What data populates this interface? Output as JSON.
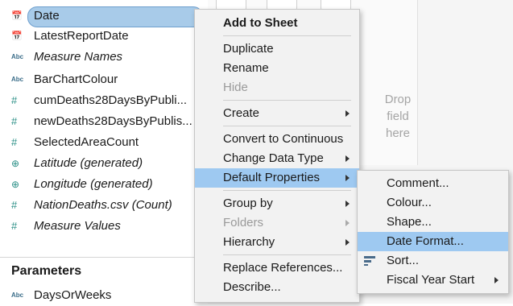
{
  "fields": [
    {
      "label": "Date",
      "icon": "calendar-icon",
      "italic": false,
      "selected": true
    },
    {
      "label": "LatestReportDate",
      "icon": "calendar-icon",
      "italic": false
    },
    {
      "label": "Measure Names",
      "icon": "abc-icon",
      "italic": true
    },
    {
      "label": "BarChartColour",
      "icon": "abc-icon",
      "italic": false
    },
    {
      "label": "cumDeaths28DaysByPubli...",
      "icon": "number-icon",
      "italic": false
    },
    {
      "label": "newDeaths28DaysByPublis...",
      "icon": "number-icon",
      "italic": false
    },
    {
      "label": "SelectedAreaCount",
      "icon": "number-icon",
      "italic": false
    },
    {
      "label": "Latitude (generated)",
      "icon": "globe-icon",
      "italic": true
    },
    {
      "label": "Longitude (generated)",
      "icon": "globe-icon",
      "italic": true
    },
    {
      "label": "NationDeaths.csv (Count)",
      "icon": "number-icon",
      "italic": true
    },
    {
      "label": "Measure Values",
      "icon": "number-icon",
      "italic": true
    }
  ],
  "icon_glyphs": {
    "abc": "Abc",
    "number": "#",
    "globe": "⊕",
    "calendar": "📅"
  },
  "parameters": {
    "title": "Parameters",
    "items": [
      {
        "label": "DaysOrWeeks",
        "icon": "abc-icon"
      }
    ]
  },
  "drop_hint": [
    "Drop",
    "field",
    "here"
  ],
  "context_menu": {
    "items": [
      {
        "label": "Add to Sheet",
        "bold": true
      },
      {
        "separator": true
      },
      {
        "label": "Duplicate"
      },
      {
        "label": "Rename"
      },
      {
        "label": "Hide",
        "disabled": true
      },
      {
        "separator": true
      },
      {
        "label": "Create",
        "submenu": true
      },
      {
        "separator": true
      },
      {
        "label": "Convert to Continuous"
      },
      {
        "label": "Change Data Type",
        "submenu": true
      },
      {
        "label": "Default Properties",
        "submenu": true,
        "highlighted": true
      },
      {
        "separator": true
      },
      {
        "label": "Group by",
        "submenu": true
      },
      {
        "label": "Folders",
        "submenu": true,
        "disabled": true
      },
      {
        "label": "Hierarchy",
        "submenu": true
      },
      {
        "separator": true
      },
      {
        "label": "Replace References..."
      },
      {
        "label": "Describe..."
      }
    ]
  },
  "submenu": {
    "items": [
      {
        "label": "Comment..."
      },
      {
        "label": "Colour..."
      },
      {
        "label": "Shape..."
      },
      {
        "label": "Date Format...",
        "highlighted": true
      },
      {
        "label": "Sort...",
        "icon": "sort-icon"
      },
      {
        "label": "Fiscal Year Start",
        "submenu": true
      }
    ]
  },
  "colors": {
    "highlight": "#9ec9f1",
    "pill": "#a8cbe9",
    "accent": "#2a8f86"
  }
}
